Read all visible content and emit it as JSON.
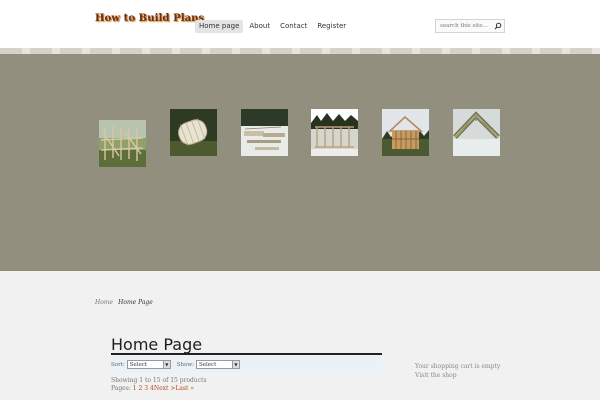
{
  "site": {
    "logo": "How to Build Plans"
  },
  "nav": {
    "items": [
      {
        "label": "Home page",
        "active": true
      },
      {
        "label": "About",
        "active": false
      },
      {
        "label": "Contact",
        "active": false
      },
      {
        "label": "Register",
        "active": false
      }
    ]
  },
  "search": {
    "placeholder": "search this site..."
  },
  "banner": {
    "thumbnails": [
      {
        "subject": "timber frame scaffold"
      },
      {
        "subject": "round log cabin kit"
      },
      {
        "subject": "lumber on snow"
      },
      {
        "subject": "wall framing in forest"
      },
      {
        "subject": "house frame under construction"
      },
      {
        "subject": "roof truss"
      }
    ]
  },
  "breadcrumb": {
    "home": "Home",
    "current": "Home Page"
  },
  "page": {
    "title": "Home Page"
  },
  "filters": {
    "sort_label": "Sort:",
    "sort_value": "Select",
    "show_label": "Show:",
    "show_value": "Select"
  },
  "results": {
    "showing": "Showing 1 to 15 of 15 products",
    "pages_label": "Pages:",
    "page_1": "1",
    "page_2": "2",
    "page_3": "3",
    "page_4": "4",
    "next": "Next >",
    "last": "Last »"
  },
  "cart": {
    "status": "Your shopping cart is empty",
    "visit": "Visit the shop"
  },
  "colors": {
    "banner": "#928f7f",
    "link": "#b34a20",
    "filter_bar": "#eaf1f7"
  }
}
